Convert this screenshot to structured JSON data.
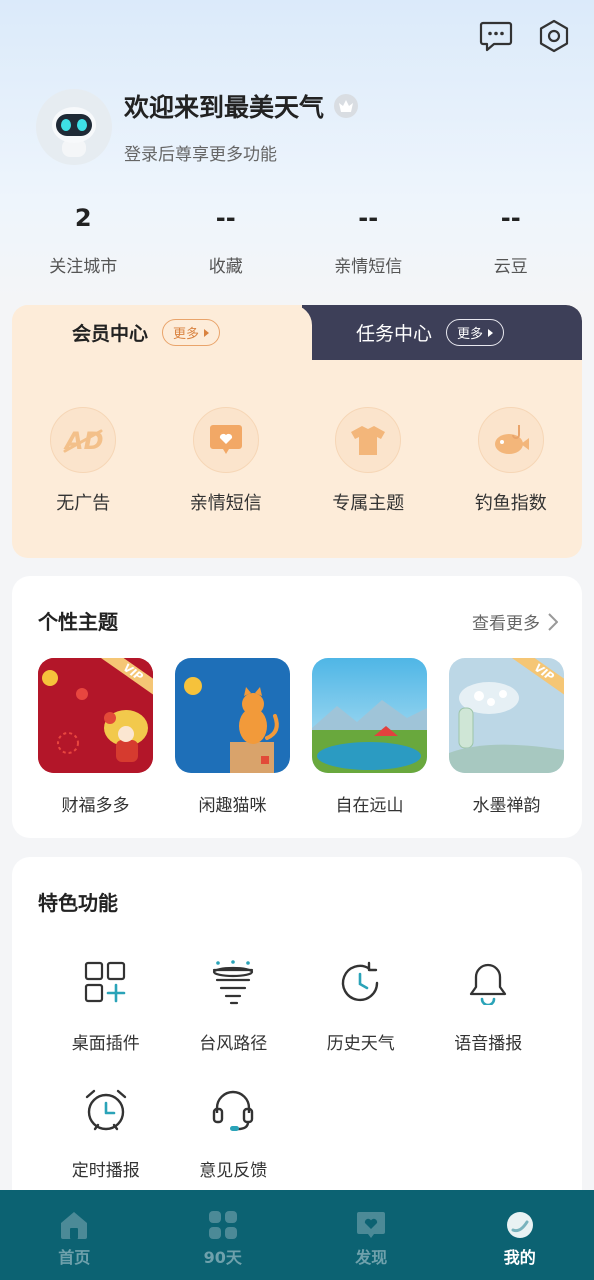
{
  "profile": {
    "welcome": "欢迎来到最美天气",
    "subtitle": "登录后尊享更多功能"
  },
  "stats": [
    {
      "value": "2",
      "label": "关注城市"
    },
    {
      "value": "--",
      "label": "收藏"
    },
    {
      "value": "--",
      "label": "亲情短信"
    },
    {
      "value": "--",
      "label": "云豆"
    }
  ],
  "member": {
    "tab_left": "会员中心",
    "tab_right": "任务中心",
    "more": "更多",
    "benefits": [
      {
        "label": "无广告",
        "icon": "no-ad-icon"
      },
      {
        "label": "亲情短信",
        "icon": "heart-message-icon"
      },
      {
        "label": "专属主题",
        "icon": "tshirt-icon"
      },
      {
        "label": "钓鱼指数",
        "icon": "fish-icon"
      }
    ]
  },
  "themes": {
    "title": "个性主题",
    "see_more": "查看更多",
    "items": [
      {
        "name": "财福多多",
        "vip": "VIP"
      },
      {
        "name": "闲趣猫咪"
      },
      {
        "name": "自在远山"
      },
      {
        "name": "水墨禅韵",
        "vip": "VIP"
      }
    ]
  },
  "features": {
    "title": "特色功能",
    "items": [
      {
        "label": "桌面插件",
        "icon": "widget-add-icon"
      },
      {
        "label": "台风路径",
        "icon": "typhoon-icon"
      },
      {
        "label": "历史天气",
        "icon": "history-clock-icon"
      },
      {
        "label": "语音播报",
        "icon": "bell-icon"
      },
      {
        "label": "定时播报",
        "icon": "alarm-clock-icon"
      },
      {
        "label": "意见反馈",
        "icon": "headset-icon"
      }
    ]
  },
  "nav": [
    {
      "label": "首页",
      "icon": "home-icon"
    },
    {
      "label": "90天",
      "icon": "grid-icon"
    },
    {
      "label": "发现",
      "icon": "discover-icon"
    },
    {
      "label": "我的",
      "icon": "profile-icon",
      "active": true
    }
  ],
  "colors": {
    "nav_bg": "#0c6272",
    "member_bg": "#fdecd9",
    "task_tab_bg": "#3d3f58",
    "accent_orange": "#d9823f",
    "icon_teal": "#2aa3b8"
  }
}
